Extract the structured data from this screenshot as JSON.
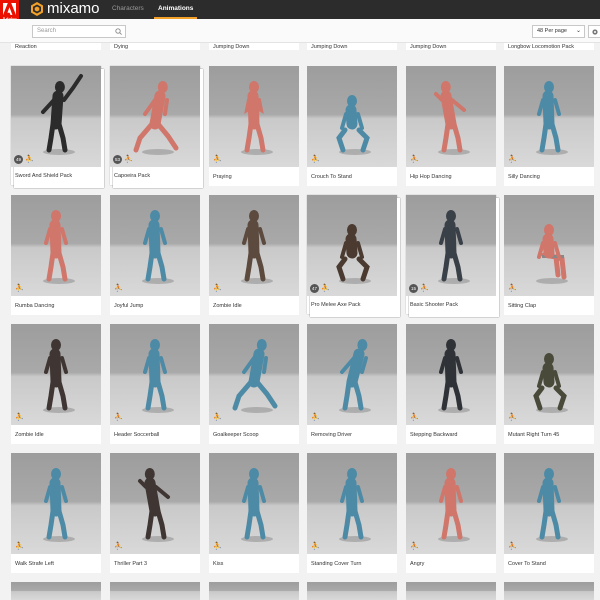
{
  "header": {
    "adobe_label": "Adobe",
    "logo": "mixamo",
    "tabs": [
      {
        "label": "Characters",
        "active": false
      },
      {
        "label": "Animations",
        "active": true
      }
    ],
    "accent": "#f3a128",
    "adobe_red": "#eb1000"
  },
  "toolbar": {
    "search_placeholder": "Search",
    "per_page": "48 Per page",
    "settings_icon": "gear-icon"
  },
  "top_row": [
    {
      "label": "Reaction"
    },
    {
      "label": "Dying"
    },
    {
      "label": "Jumping Down"
    },
    {
      "label": "Jumping Down"
    },
    {
      "label": "Jumping Down"
    },
    {
      "label": "Longbow Locomotion Pack"
    }
  ],
  "cards": [
    {
      "label": "Sword And Shield Pack",
      "count": "49",
      "character": "knight",
      "color": "#2b2b2b",
      "pose": "swing"
    },
    {
      "label": "Capoeira Pack",
      "count": "53",
      "character": "mannequin",
      "color": "#d0766a",
      "pose": "lunge"
    },
    {
      "label": "Praying",
      "count": "",
      "character": "mannequin",
      "color": "#d0766a",
      "pose": "pray"
    },
    {
      "label": "Crouch To Stand",
      "count": "",
      "character": "robot",
      "color": "#4d8aa6",
      "pose": "crouch"
    },
    {
      "label": "Hip Hop Dancing",
      "count": "",
      "character": "mannequin",
      "color": "#d0766a",
      "pose": "dance"
    },
    {
      "label": "Silly Dancing",
      "count": "",
      "character": "robot",
      "color": "#4d8aa6",
      "pose": "stand"
    },
    {
      "label": "Rumba Dancing",
      "count": "",
      "character": "mannequin",
      "color": "#d0766a",
      "pose": "stand"
    },
    {
      "label": "Joyful Jump",
      "count": "",
      "character": "robot",
      "color": "#4d8aa6",
      "pose": "stand"
    },
    {
      "label": "Zombie Idle",
      "count": "",
      "character": "zombie",
      "color": "#5c4a3e",
      "pose": "stand"
    },
    {
      "label": "Pro Melee Axe Pack",
      "count": "47",
      "character": "brute",
      "color": "#4a3a30",
      "pose": "crouch"
    },
    {
      "label": "Basic Shooter Pack",
      "count": "15",
      "character": "soldier",
      "color": "#3a4048",
      "pose": "stand"
    },
    {
      "label": "Sitting Clap",
      "count": "",
      "character": "mannequin",
      "color": "#d0766a",
      "pose": "sit"
    },
    {
      "label": "Zombie Idle",
      "count": "",
      "character": "zombie",
      "color": "#3f3633",
      "pose": "stand"
    },
    {
      "label": "Header Soccerball",
      "count": "",
      "character": "robot",
      "color": "#4d8aa6",
      "pose": "stand"
    },
    {
      "label": "Goalkeeper Scoop",
      "count": "",
      "character": "robot",
      "color": "#4d8aa6",
      "pose": "lunge"
    },
    {
      "label": "Removing Driver",
      "count": "",
      "character": "robot",
      "color": "#4d8aa6",
      "pose": "bend"
    },
    {
      "label": "Stepping Backward",
      "count": "",
      "character": "soldier",
      "color": "#2f3338",
      "pose": "stand"
    },
    {
      "label": "Mutant Right Turn 45",
      "count": "",
      "character": "mutant",
      "color": "#4a4a3a",
      "pose": "crouch"
    },
    {
      "label": "Walk Strafe Left",
      "count": "",
      "character": "robot",
      "color": "#4d8aa6",
      "pose": "stand"
    },
    {
      "label": "Thriller Part 3",
      "count": "",
      "character": "zombie",
      "color": "#3f3633",
      "pose": "dance"
    },
    {
      "label": "Kiss",
      "count": "",
      "character": "robot",
      "color": "#4d8aa6",
      "pose": "stand"
    },
    {
      "label": "Standing Cover Turn",
      "count": "",
      "character": "robot",
      "color": "#4d8aa6",
      "pose": "stand"
    },
    {
      "label": "Angry",
      "count": "",
      "character": "mannequin",
      "color": "#d0766a",
      "pose": "stand"
    },
    {
      "label": "Cover To Stand",
      "count": "",
      "character": "robot",
      "color": "#4d8aa6",
      "pose": "stand"
    }
  ]
}
